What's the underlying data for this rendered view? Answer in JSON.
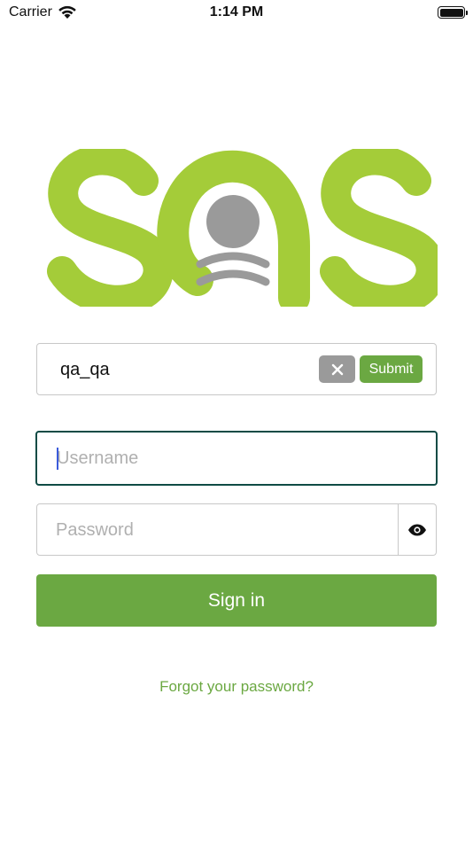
{
  "status_bar": {
    "carrier": "Carrier",
    "time": "1:14 PM",
    "icons": [
      "wifi-icon",
      "battery-icon"
    ]
  },
  "logo": {
    "text": "SQS",
    "colors": {
      "green": "#a4cc39",
      "gray": "#9a9a9a"
    }
  },
  "server": {
    "value": "qa_qa",
    "submit_label": "Submit",
    "clear_icon": "close-icon"
  },
  "login": {
    "username_placeholder": "Username",
    "password_placeholder": "Password",
    "eye_icon": "eye-icon",
    "signin_label": "Sign in",
    "forgot_label": "Forgot your password?"
  },
  "colors": {
    "accent": "#6ba842",
    "focus_border": "#0f4b45",
    "border": "#c8c8c8"
  }
}
